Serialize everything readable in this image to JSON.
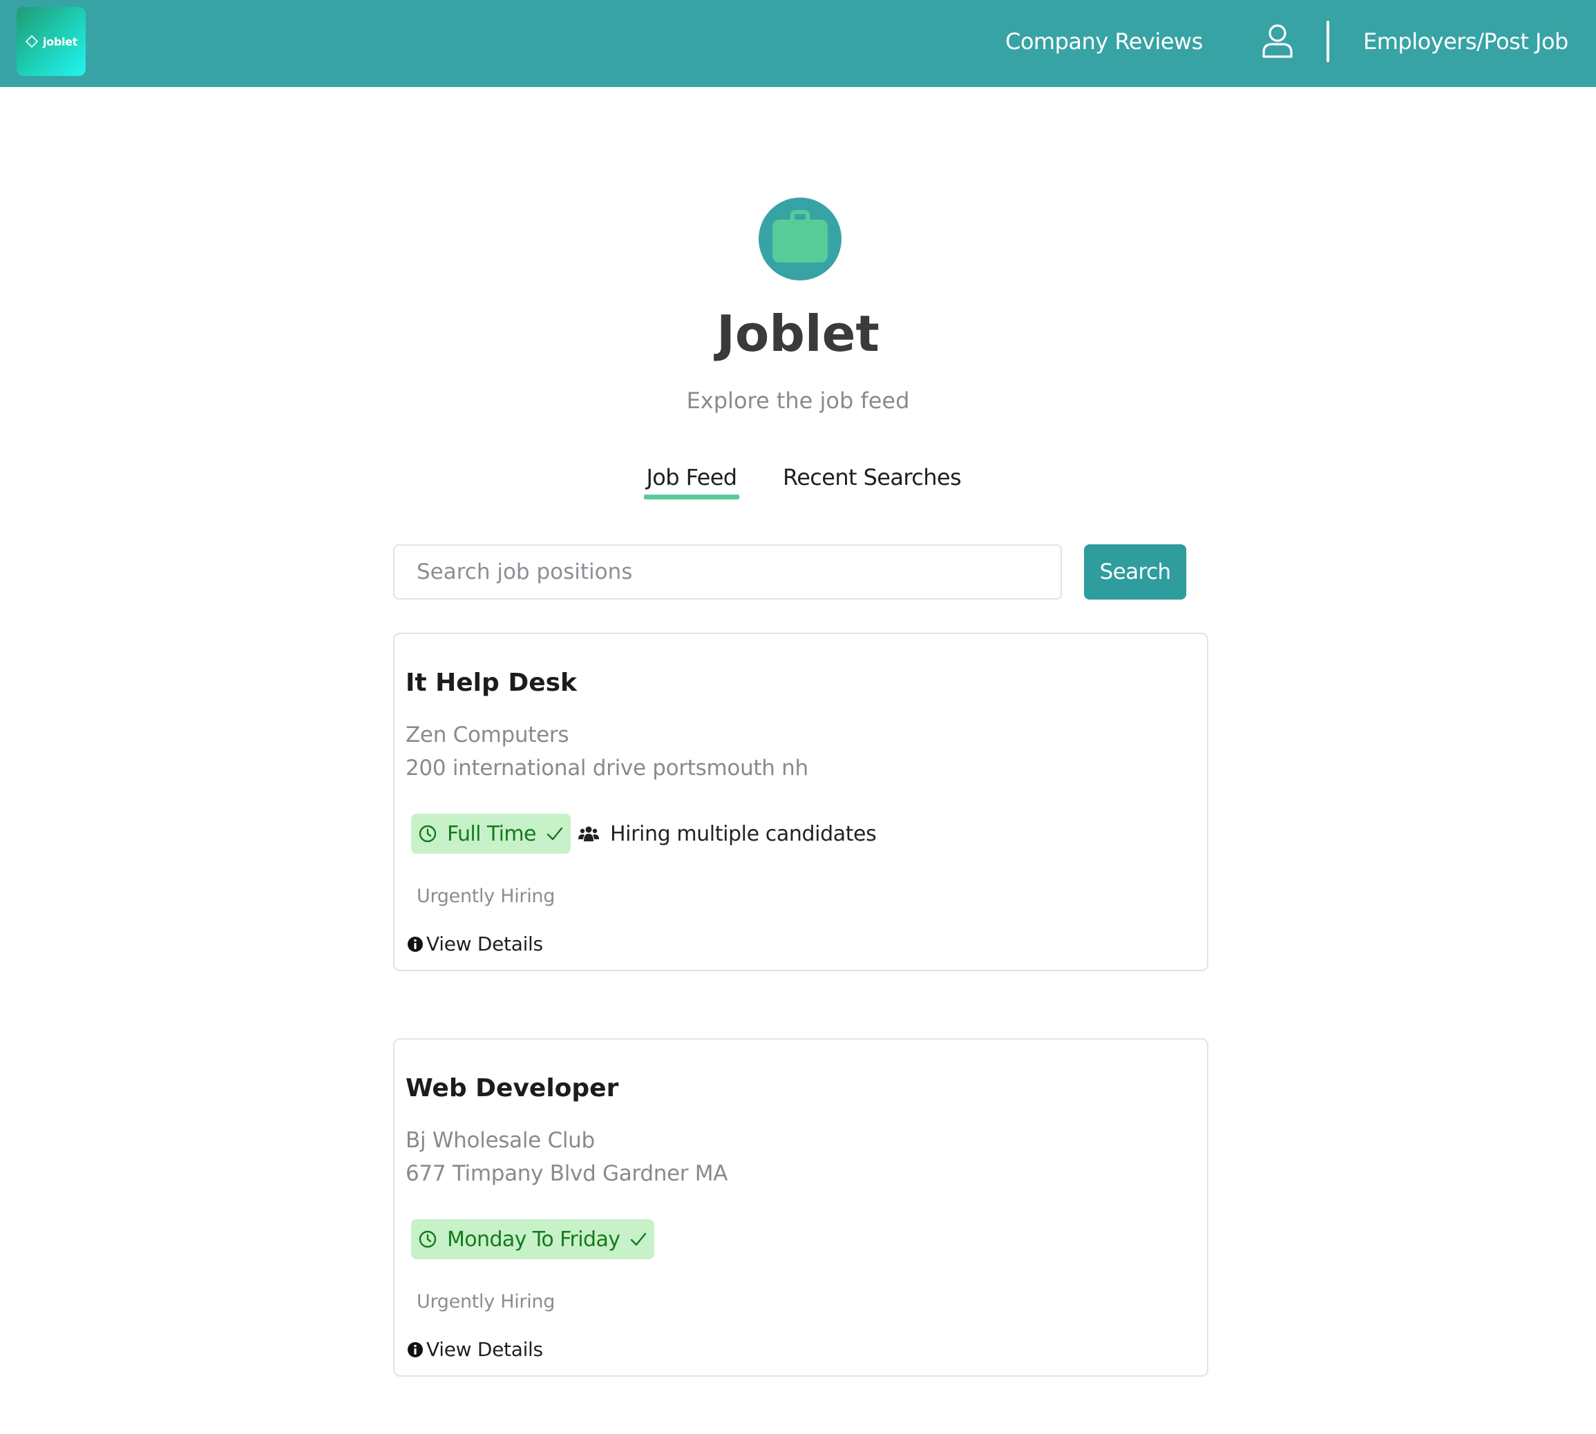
{
  "header": {
    "logo_text": "joblet",
    "nav": {
      "company_reviews": "Company Reviews",
      "employers_post_job": "Employers/Post Job"
    },
    "icons": [
      "joblet-logo-icon",
      "user-icon"
    ],
    "background_color": "#38a3a5"
  },
  "hero": {
    "icon": "briefcase-icon",
    "title": "Joblet",
    "subtitle": "Explore the job feed"
  },
  "tabs": [
    {
      "label": "Job Feed",
      "active": true
    },
    {
      "label": "Recent Searches",
      "active": false
    }
  ],
  "search": {
    "placeholder": "Search job positions",
    "value": "",
    "button_label": "Search"
  },
  "jobs": [
    {
      "title": "It Help Desk",
      "company": "Zen Computers",
      "address": "200 international drive portsmouth nh",
      "schedule": "Full Time",
      "hiring": "Hiring multiple candidates",
      "urgency": "Urgently Hiring",
      "details_label": "View Details"
    },
    {
      "title": "Web Developer",
      "company": "Bj Wholesale Club",
      "address": "677 Timpany Blvd Gardner MA",
      "schedule": "Monday To Friday",
      "hiring": "",
      "urgency": "Urgently Hiring",
      "details_label": "View Details"
    }
  ],
  "colors": {
    "primary": "#38a3a5",
    "button": "#2f9c9e",
    "accent_underline": "#57cc99",
    "briefcase": "#57cc99",
    "badge_bg": "#c7f1c8",
    "badge_text": "#147a1c"
  }
}
